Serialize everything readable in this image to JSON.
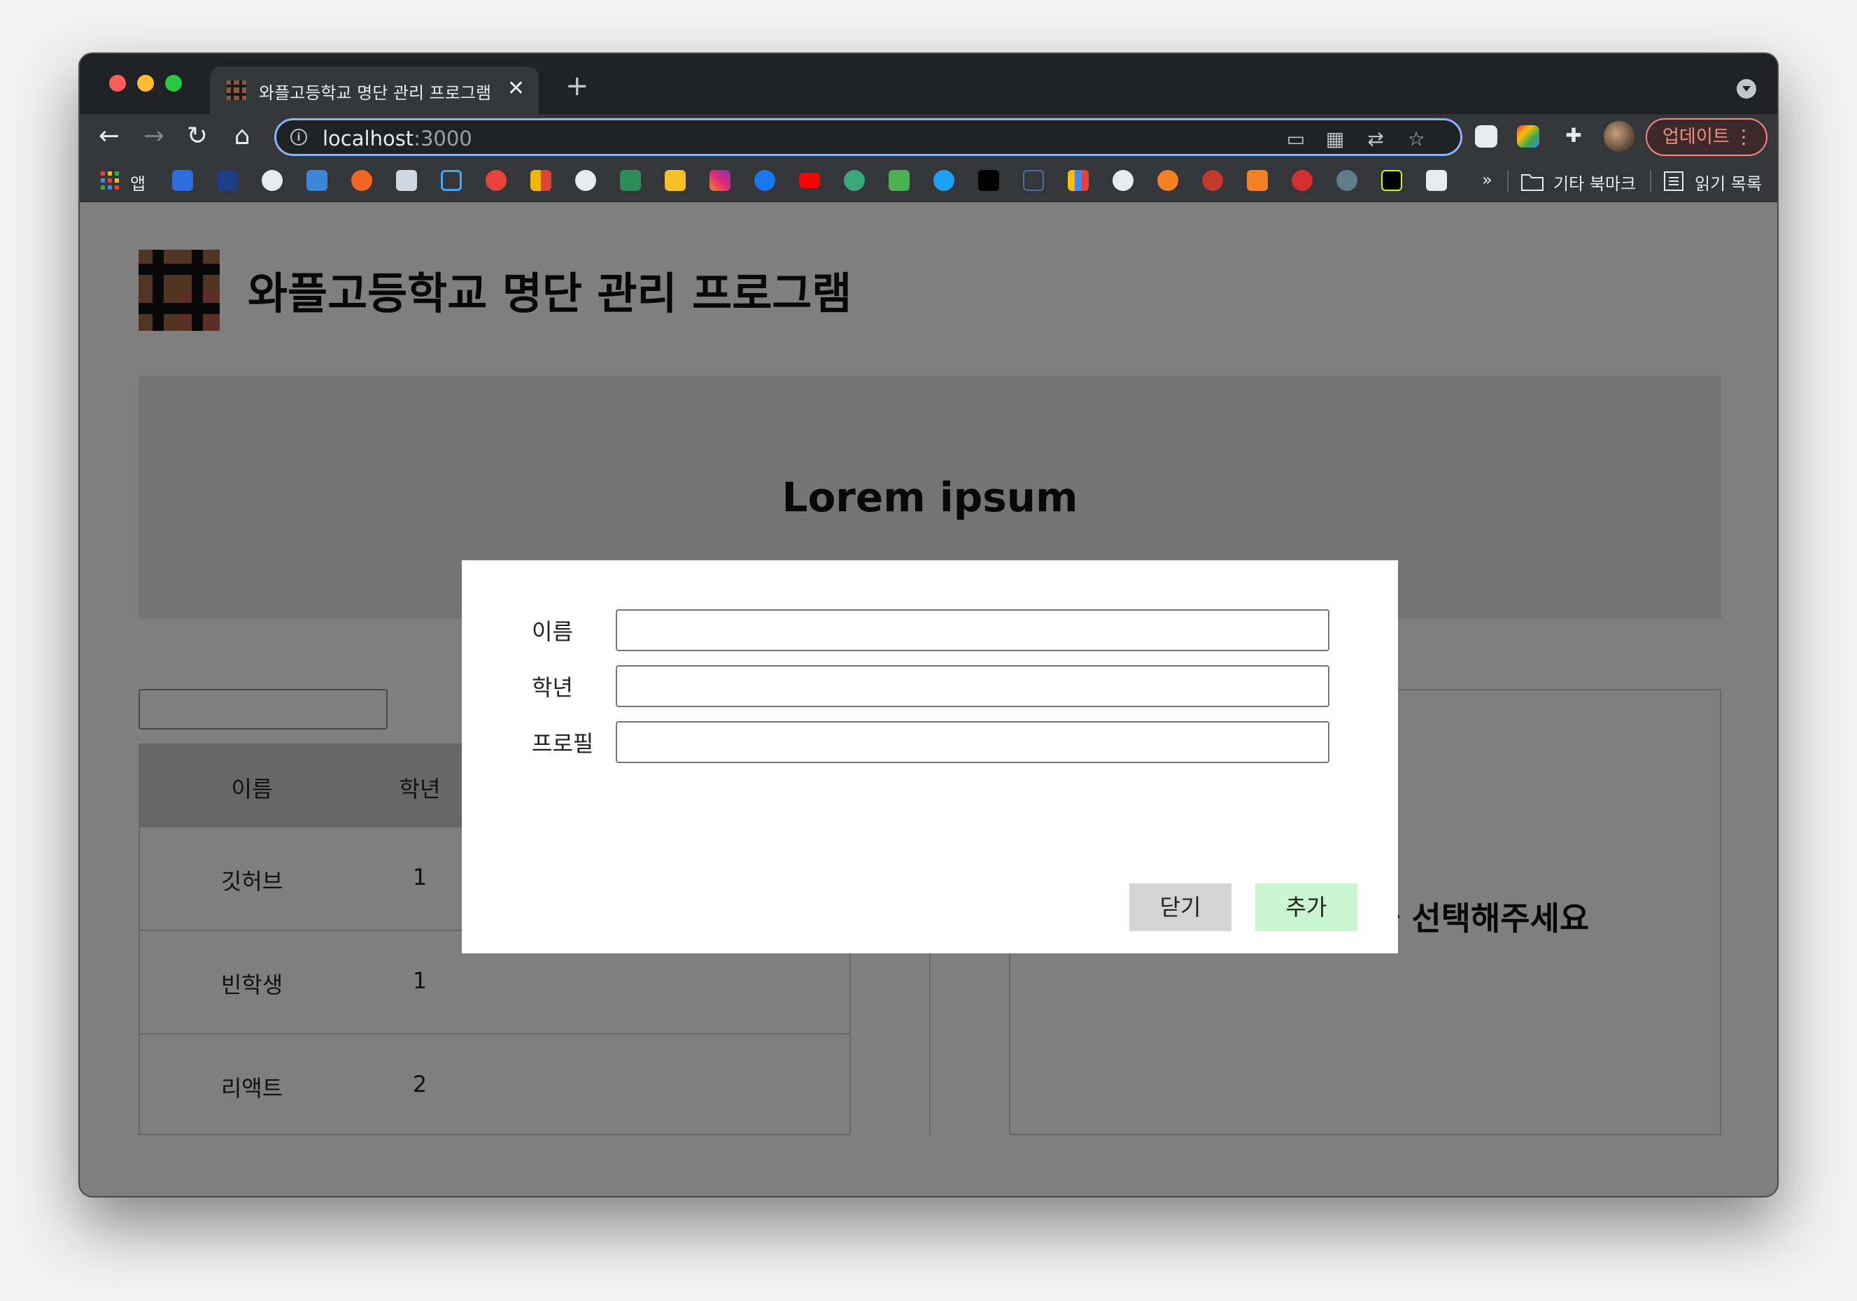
{
  "browser": {
    "tab_title": "와플고등학교 명단 관리 프로그램",
    "url_host": "localhost",
    "url_port": ":3000",
    "update_label": "업데이트",
    "bookmarks": {
      "apps_label": "앱",
      "overflow_label": "»",
      "other_bookmarks_label": "기타 북마크",
      "reading_list_label": "읽기 목록"
    }
  },
  "page": {
    "title": "와플고등학교 명단 관리 프로그램",
    "hero_title": "Lorem ipsum",
    "search": {
      "placeholder": ""
    },
    "table": {
      "columns": [
        "이름",
        "학년"
      ],
      "rows": [
        {
          "name": "깃허브",
          "grade": "1"
        },
        {
          "name": "빈학생",
          "grade": "1"
        },
        {
          "name": "리액트",
          "grade": "2"
        }
      ]
    },
    "detail": {
      "empty_message": "왼쪽 표에서 학생을 선택해주세요"
    }
  },
  "modal": {
    "fields": [
      {
        "label": "이름",
        "value": ""
      },
      {
        "label": "학년",
        "value": ""
      },
      {
        "label": "프로필",
        "value": ""
      }
    ],
    "close_label": "닫기",
    "add_label": "추가"
  },
  "colors": {
    "accent_blue": "#8ab4f8",
    "update_red": "#f28b82",
    "add_button_green": "#c9f5cf",
    "close_button_gray": "#d4d4d4",
    "overlay": "rgba(0,0,0,0.5)"
  }
}
